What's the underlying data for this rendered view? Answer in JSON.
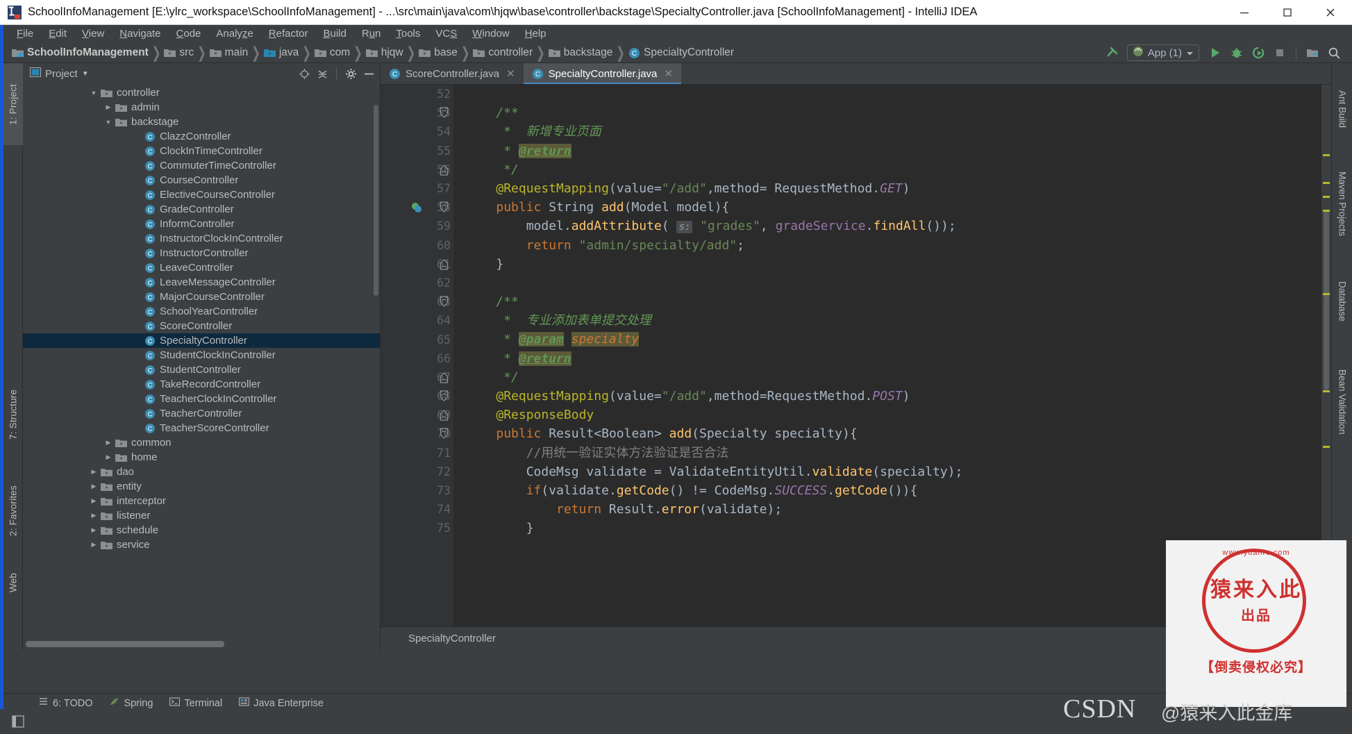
{
  "window": {
    "title": "SchoolInfoManagement [E:\\ylrc_workspace\\SchoolInfoManagement] - ...\\src\\main\\java\\com\\hjqw\\base\\controller\\backstage\\SpecialtyController.java [SchoolInfoManagement] - IntelliJ IDEA",
    "minimize_label": "minimize-icon",
    "maximize_label": "maximize-icon",
    "close_label": "close-icon"
  },
  "menubar": {
    "items": [
      {
        "label": "File",
        "mnemonic": "F"
      },
      {
        "label": "Edit",
        "mnemonic": "E"
      },
      {
        "label": "View",
        "mnemonic": "V"
      },
      {
        "label": "Navigate",
        "mnemonic": "N"
      },
      {
        "label": "Code",
        "mnemonic": "C"
      },
      {
        "label": "Analyze",
        "mnemonic": "z"
      },
      {
        "label": "Refactor",
        "mnemonic": "R"
      },
      {
        "label": "Build",
        "mnemonic": "B"
      },
      {
        "label": "Run",
        "mnemonic": "u"
      },
      {
        "label": "Tools",
        "mnemonic": "T"
      },
      {
        "label": "VCS",
        "mnemonic": "S"
      },
      {
        "label": "Window",
        "mnemonic": "W"
      },
      {
        "label": "Help",
        "mnemonic": "H"
      }
    ]
  },
  "breadcrumbs": [
    {
      "label": "SchoolInfoManagement",
      "icon": "project-module-icon"
    },
    {
      "label": "src",
      "icon": "folder-icon"
    },
    {
      "label": "main",
      "icon": "folder-icon"
    },
    {
      "label": "java",
      "icon": "source-folder-icon"
    },
    {
      "label": "com",
      "icon": "folder-icon"
    },
    {
      "label": "hjqw",
      "icon": "folder-icon"
    },
    {
      "label": "base",
      "icon": "folder-icon"
    },
    {
      "label": "controller",
      "icon": "folder-icon"
    },
    {
      "label": "backstage",
      "icon": "folder-icon"
    },
    {
      "label": "SpecialtyController",
      "icon": "java-class-icon"
    }
  ],
  "toolbar": {
    "run_config": "App (1)",
    "buttons": [
      "build-hammer-icon",
      "run-icon",
      "debug-icon",
      "run-coverage-icon",
      "stop-icon",
      "project-structure-icon",
      "search-everywhere-icon"
    ]
  },
  "left_tool_tabs": [
    {
      "label": "1: Project",
      "active": true
    },
    {
      "label": "7: Structure",
      "active": false
    },
    {
      "label": "2: Favorites",
      "active": false
    },
    {
      "label": "Web",
      "active": false
    }
  ],
  "right_tool_tabs": [
    {
      "label": "Ant Build"
    },
    {
      "label": "Maven Projects"
    },
    {
      "label": "Database"
    },
    {
      "label": "Bean Validation"
    }
  ],
  "project_panel": {
    "title": "Project",
    "header_icons": [
      "locate-icon",
      "collapse-all-icon",
      "settings-gear-icon",
      "hide-icon"
    ],
    "tree": [
      {
        "label": "controller",
        "icon": "folder-icon",
        "indent": 4,
        "arrow": "down",
        "selected": false
      },
      {
        "label": "admin",
        "icon": "folder-icon",
        "indent": 5,
        "arrow": "right",
        "selected": false
      },
      {
        "label": "backstage",
        "icon": "folder-icon",
        "indent": 5,
        "arrow": "down",
        "selected": false
      },
      {
        "label": "ClazzController",
        "icon": "java-class-icon",
        "indent": 7,
        "arrow": "none",
        "selected": false
      },
      {
        "label": "ClockInTimeController",
        "icon": "java-class-icon",
        "indent": 7,
        "arrow": "none",
        "selected": false
      },
      {
        "label": "CommuterTimeController",
        "icon": "java-class-icon",
        "indent": 7,
        "arrow": "none",
        "selected": false
      },
      {
        "label": "CourseController",
        "icon": "java-class-icon",
        "indent": 7,
        "arrow": "none",
        "selected": false
      },
      {
        "label": "ElectiveCourseController",
        "icon": "java-class-icon",
        "indent": 7,
        "arrow": "none",
        "selected": false
      },
      {
        "label": "GradeController",
        "icon": "java-class-icon",
        "indent": 7,
        "arrow": "none",
        "selected": false
      },
      {
        "label": "InformController",
        "icon": "java-class-icon",
        "indent": 7,
        "arrow": "none",
        "selected": false
      },
      {
        "label": "InstructorClockInController",
        "icon": "java-class-icon",
        "indent": 7,
        "arrow": "none",
        "selected": false
      },
      {
        "label": "InstructorController",
        "icon": "java-class-icon",
        "indent": 7,
        "arrow": "none",
        "selected": false
      },
      {
        "label": "LeaveController",
        "icon": "java-class-icon",
        "indent": 7,
        "arrow": "none",
        "selected": false
      },
      {
        "label": "LeaveMessageController",
        "icon": "java-class-icon",
        "indent": 7,
        "arrow": "none",
        "selected": false
      },
      {
        "label": "MajorCourseController",
        "icon": "java-class-icon",
        "indent": 7,
        "arrow": "none",
        "selected": false
      },
      {
        "label": "SchoolYearController",
        "icon": "java-class-icon",
        "indent": 7,
        "arrow": "none",
        "selected": false
      },
      {
        "label": "ScoreController",
        "icon": "java-class-icon",
        "indent": 7,
        "arrow": "none",
        "selected": false
      },
      {
        "label": "SpecialtyController",
        "icon": "java-class-icon",
        "indent": 7,
        "arrow": "none",
        "selected": true
      },
      {
        "label": "StudentClockInController",
        "icon": "java-class-icon",
        "indent": 7,
        "arrow": "none",
        "selected": false
      },
      {
        "label": "StudentController",
        "icon": "java-class-icon",
        "indent": 7,
        "arrow": "none",
        "selected": false
      },
      {
        "label": "TakeRecordController",
        "icon": "java-class-icon",
        "indent": 7,
        "arrow": "none",
        "selected": false
      },
      {
        "label": "TeacherClockInController",
        "icon": "java-class-icon",
        "indent": 7,
        "arrow": "none",
        "selected": false
      },
      {
        "label": "TeacherController",
        "icon": "java-class-icon",
        "indent": 7,
        "arrow": "none",
        "selected": false
      },
      {
        "label": "TeacherScoreController",
        "icon": "java-class-icon",
        "indent": 7,
        "arrow": "none",
        "selected": false
      },
      {
        "label": "common",
        "icon": "folder-icon",
        "indent": 5,
        "arrow": "right",
        "selected": false
      },
      {
        "label": "home",
        "icon": "folder-icon",
        "indent": 5,
        "arrow": "right",
        "selected": false
      },
      {
        "label": "dao",
        "icon": "folder-icon",
        "indent": 4,
        "arrow": "right",
        "selected": false
      },
      {
        "label": "entity",
        "icon": "folder-icon",
        "indent": 4,
        "arrow": "right",
        "selected": false
      },
      {
        "label": "interceptor",
        "icon": "folder-icon",
        "indent": 4,
        "arrow": "right",
        "selected": false
      },
      {
        "label": "listener",
        "icon": "folder-icon",
        "indent": 4,
        "arrow": "right",
        "selected": false
      },
      {
        "label": "schedule",
        "icon": "folder-icon",
        "indent": 4,
        "arrow": "right",
        "selected": false
      },
      {
        "label": "service",
        "icon": "folder-icon",
        "indent": 4,
        "arrow": "right",
        "selected": false
      }
    ]
  },
  "editor": {
    "tabs": [
      {
        "label": "ScoreController.java",
        "active": false,
        "icon": "java-class-icon"
      },
      {
        "label": "SpecialtyController.java",
        "active": true,
        "icon": "java-class-icon"
      }
    ],
    "first_line": 52,
    "lines": [
      {
        "num": 52,
        "text": ""
      },
      {
        "num": 53,
        "text": "    /**",
        "fold": "start"
      },
      {
        "num": 54,
        "text": "     *  新增专业页面"
      },
      {
        "num": 55,
        "text": "     * @return"
      },
      {
        "num": 56,
        "text": "     */",
        "fold": "end"
      },
      {
        "num": 57,
        "text": "    @RequestMapping(value=\"/add\",method= RequestMethod.GET)"
      },
      {
        "num": 58,
        "text": "    public String add(Model model){",
        "fold": "start",
        "gutter_icon": "spring-bean-icon"
      },
      {
        "num": 59,
        "text": "        model.addAttribute( s: \"grades\", gradeService.findAll());"
      },
      {
        "num": 60,
        "text": "        return \"admin/specialty/add\";"
      },
      {
        "num": 61,
        "text": "    }",
        "fold": "end"
      },
      {
        "num": 62,
        "text": ""
      },
      {
        "num": 63,
        "text": "    /**",
        "fold": "start"
      },
      {
        "num": 64,
        "text": "     *  专业添加表单提交处理"
      },
      {
        "num": 65,
        "text": "     * @param specialty"
      },
      {
        "num": 66,
        "text": "     * @return"
      },
      {
        "num": 67,
        "text": "     */",
        "fold": "end"
      },
      {
        "num": 68,
        "text": "    @RequestMapping(value=\"/add\",method=RequestMethod.POST)",
        "fold": "start"
      },
      {
        "num": 69,
        "text": "    @ResponseBody",
        "fold": "end"
      },
      {
        "num": 70,
        "text": "    public Result<Boolean> add(Specialty specialty){",
        "fold": "start"
      },
      {
        "num": 71,
        "text": "        //用统一验证实体方法验证是否合法"
      },
      {
        "num": 72,
        "text": "        CodeMsg validate = ValidateEntityUtil.validate(specialty);"
      },
      {
        "num": 73,
        "text": "        if(validate.getCode() != CodeMsg.SUCCESS.getCode()){"
      },
      {
        "num": 74,
        "text": "            return Result.error(validate);"
      },
      {
        "num": 75,
        "text": "        }"
      }
    ],
    "breadcrumb_bottom": "SpecialtyController"
  },
  "statusbar": {
    "items": [
      {
        "label": "6: TODO",
        "icon": "todo-icon"
      },
      {
        "label": "Spring",
        "icon": "spring-leaf-icon"
      },
      {
        "label": "Terminal",
        "icon": "terminal-icon"
      },
      {
        "label": "Java Enterprise",
        "icon": "java-enterprise-icon"
      }
    ]
  },
  "watermark": {
    "csdn": "CSDN",
    "user": "@猿来入此金库",
    "stamp_top": "www.yuanrc.com",
    "stamp_main": "猿来入此",
    "stamp_sub": "出品",
    "stamp_bottom": "【倒卖侵权必究】"
  },
  "colors": {
    "accent_blue": "#1a56d6",
    "panel_bg": "#3c3f41",
    "editor_bg": "#2b2b2b",
    "selection": "#0d293e",
    "tab_active": "#4e5254",
    "keyword": "#cc7832",
    "string": "#6a8759",
    "annotation": "#bbb529",
    "comment": "#629755",
    "field": "#9876aa",
    "method": "#ffc66d",
    "stamp_red": "#cf3030"
  }
}
